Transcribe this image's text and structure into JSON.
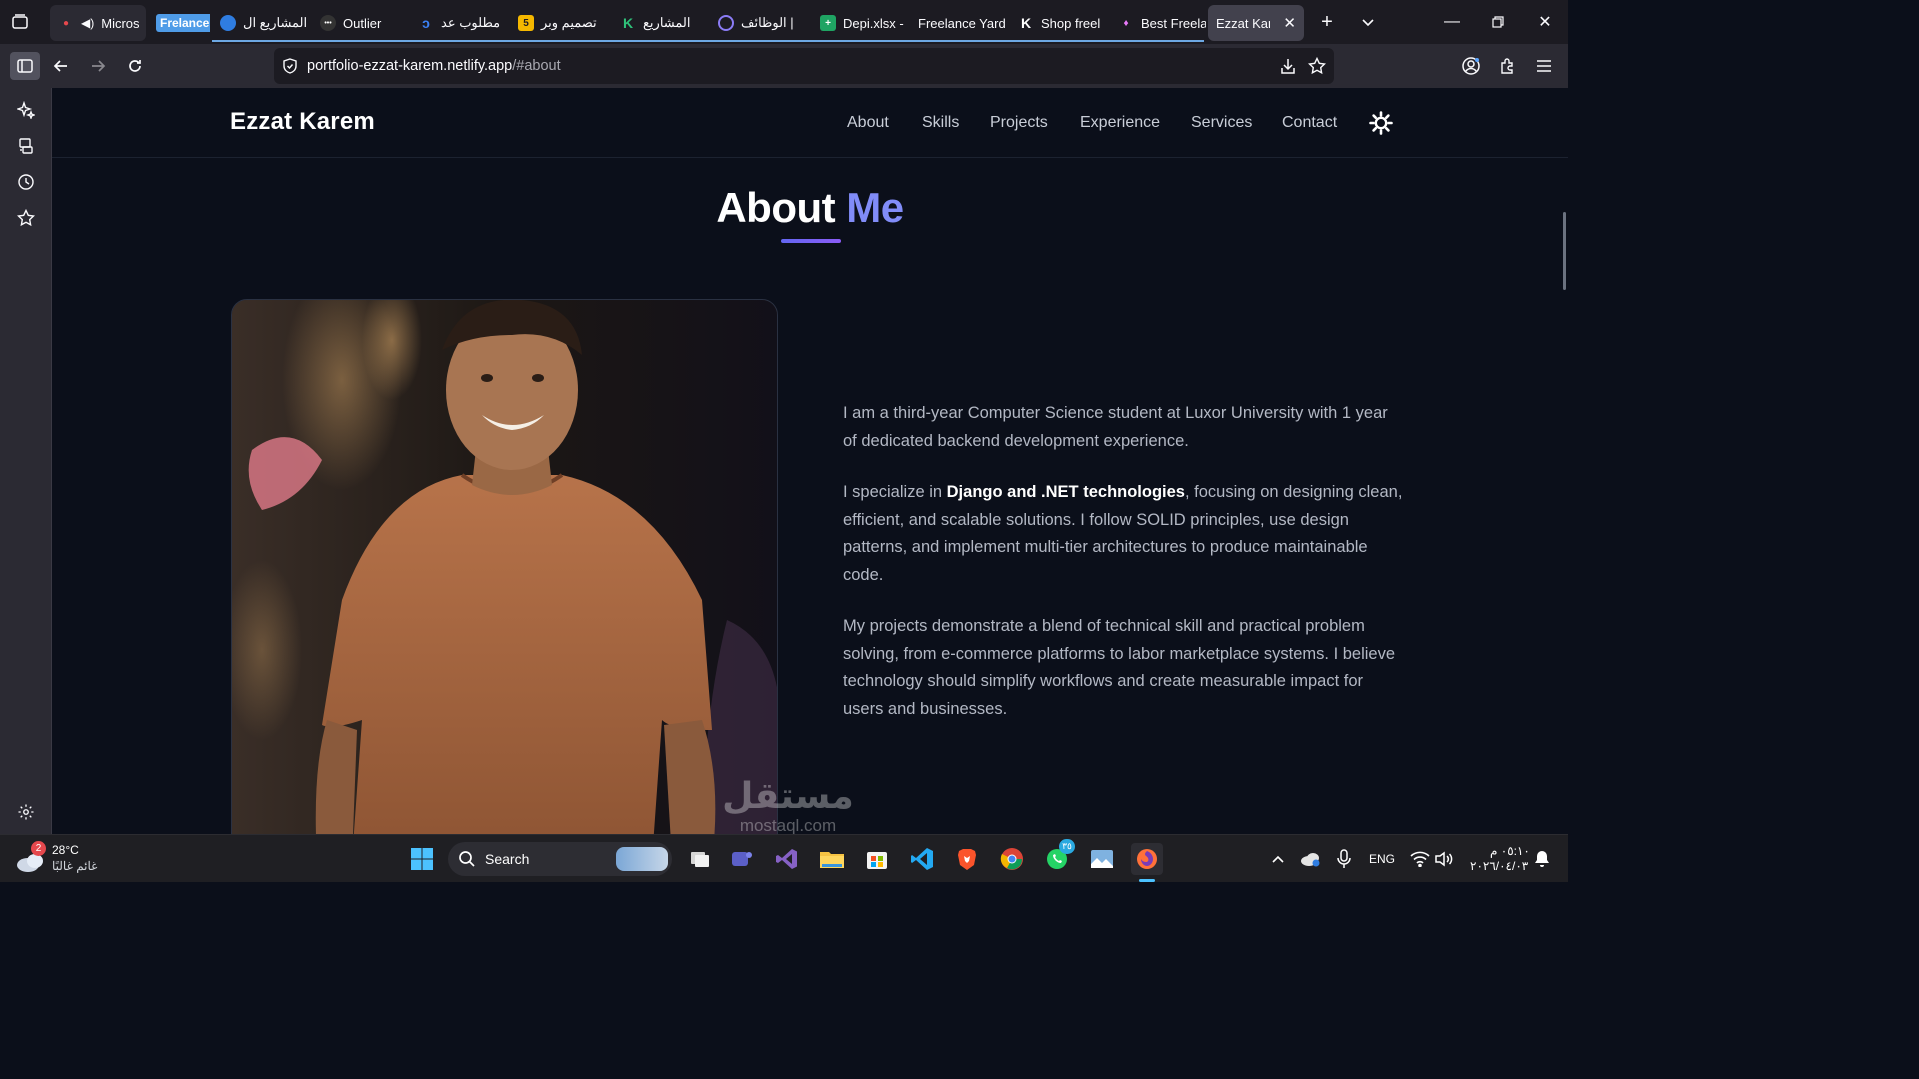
{
  "browser": {
    "tabs": [
      {
        "label": "Micros",
        "icon": "mic-icon"
      },
      {
        "label": "Frelance",
        "icon": "frelance-badge"
      },
      {
        "label": "المشاريع ال",
        "icon": "circle-blue-icon"
      },
      {
        "label": "Outlier",
        "icon": "outlier-icon"
      },
      {
        "label": "مطلوب عد",
        "icon": "swirl-icon"
      },
      {
        "label": "تصميم وبر",
        "icon": "five-icon"
      },
      {
        "label": "المشاريع",
        "icon": "k-green-icon"
      },
      {
        "label": "الوظائف |",
        "icon": "purple-ring-icon"
      },
      {
        "label": "Depi.xlsx -",
        "icon": "sheets-icon"
      },
      {
        "label": "Freelance Yard",
        "icon": ""
      },
      {
        "label": "Shop freel",
        "icon": "k-icon"
      },
      {
        "label": "Best Freela",
        "icon": "balloon-icon"
      },
      {
        "label": "Ezzat Karem",
        "icon": ""
      }
    ],
    "url_host": "portfolio-ezzat-karem.netlify.app",
    "url_path": "/#about"
  },
  "site": {
    "brand": "Ezzat Karem",
    "nav": [
      "About",
      "Skills",
      "Projects",
      "Experience",
      "Services",
      "Contact"
    ],
    "heading_main": "About",
    "heading_accent": "Me",
    "para1": "I am a third-year Computer Science student at Luxor University with 1 year of dedicated backend development experience.",
    "para2_prefix": "I specialize in ",
    "para2_bold": "Django and .NET technologies",
    "para2_suffix": ", focusing on designing clean, efficient, and scalable solutions. I follow SOLID principles, use design patterns, and implement multi-tier architectures to produce maintainable code.",
    "para3": "My projects demonstrate a blend of technical skill and practical problem solving, from e-commerce platforms to labor marketplace systems. I believe technology should simplify workflows and create measurable impact for users and businesses.",
    "accent_color": "#818cf8"
  },
  "watermark": {
    "arabic": "مستقل",
    "latin": "mostaql.com"
  },
  "taskbar": {
    "weather_temp": "28°C",
    "weather_desc": "غائم غالبًا",
    "weather_badge": "2",
    "search_label": "Search",
    "whatsapp_badge": "٣٥",
    "lang": "ENG",
    "time": "٠٥:١٠ م",
    "date": "٢٠٢٦/٠٤/٠٣"
  }
}
